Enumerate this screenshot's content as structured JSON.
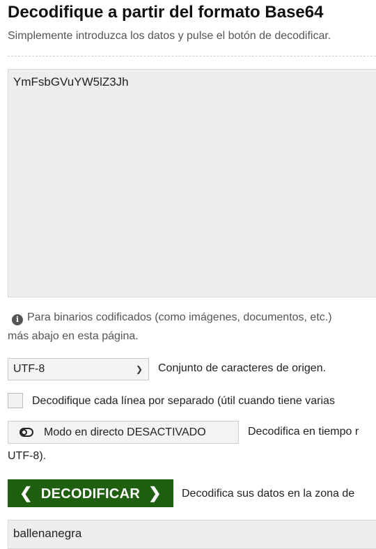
{
  "header": {
    "title": "Decodifique a partir del formato Base64",
    "subtitle": "Simplemente introduzca los datos y pulse el botón de decodificar."
  },
  "input": {
    "value": "YmFsbGVuYW5lZ3Jh"
  },
  "note": {
    "icon": "info-icon",
    "line1": "Para binarios codificados (como imágenes, documentos, etc.)",
    "line2": "más abajo en esta página."
  },
  "charset": {
    "selected": "UTF-8",
    "label": "Conjunto de caracteres de origen."
  },
  "per_line": {
    "checked": false,
    "label": "Decodifique cada línea por separado (útil cuando tiene varias"
  },
  "live_mode": {
    "icon": "toggle-off-icon",
    "button_label": "Modo en directo DESACTIVADO",
    "description_line1": "Decodifica  en  tiempo  r",
    "description_line2": "UTF-8)."
  },
  "decode": {
    "button_label": "DECODIFICAR",
    "button_color": "#1f5f10",
    "description": "Decodifica sus datos en la zona de"
  },
  "output": {
    "value": "ballenanegra"
  }
}
